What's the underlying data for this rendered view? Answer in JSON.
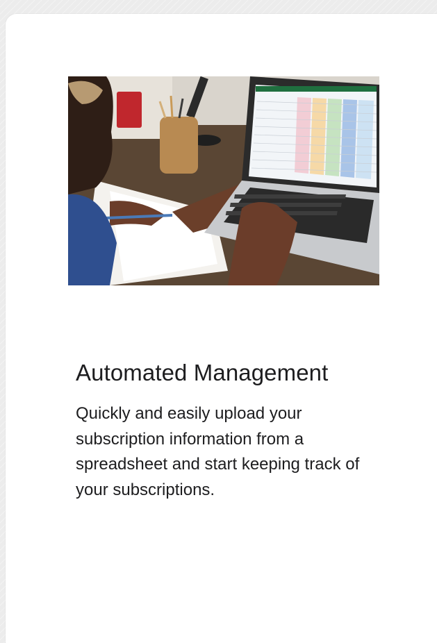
{
  "card": {
    "image_subject": "person working on a laptop showing a spreadsheet",
    "title": "Automated Management",
    "description": "Quickly and easily upload your subscription information from a spreadsheet and start keeping track of your subscriptions."
  },
  "colors": {
    "card_background": "#ffffff",
    "page_background": "#ececec",
    "text": "#1d1d1f"
  }
}
